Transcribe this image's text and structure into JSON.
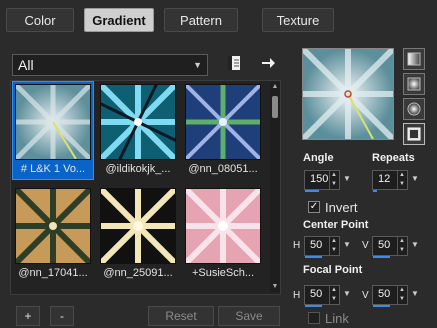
{
  "tabs": [
    {
      "label": "Color",
      "active": false
    },
    {
      "label": "Gradient",
      "active": true
    },
    {
      "label": "Pattern",
      "active": false
    },
    {
      "label": "Texture",
      "active": false
    }
  ],
  "category": {
    "selected": "All"
  },
  "thumbnails": [
    {
      "label": "# L&K 1 Vo...",
      "selected": true
    },
    {
      "label": "@ildikokjk_...",
      "selected": false
    },
    {
      "label": "@nn_08051...",
      "selected": false
    },
    {
      "label": "@nn_17041...",
      "selected": false
    },
    {
      "label": "@nn_25091...",
      "selected": false
    },
    {
      "label": "+SusieSch...",
      "selected": false
    }
  ],
  "buttons": {
    "add": "+",
    "remove": "-",
    "reset": "Reset",
    "save": "Save"
  },
  "angle": {
    "label": "Angle",
    "value": "150",
    "level_percent": 42
  },
  "repeats": {
    "label": "Repeats",
    "value": "12",
    "level_percent": 12
  },
  "invert": {
    "label": "Invert",
    "checked": true
  },
  "center_point": {
    "label": "Center Point",
    "h_label": "H",
    "h_value": "50",
    "v_label": "V",
    "v_value": "50"
  },
  "focal_point": {
    "label": "Focal Point",
    "h_label": "H",
    "h_value": "50",
    "v_label": "V",
    "v_value": "50"
  },
  "link": {
    "label": "Link",
    "checked": false
  },
  "colors": {
    "accent": "#3f8ce6",
    "selection": "#0a64c8"
  }
}
